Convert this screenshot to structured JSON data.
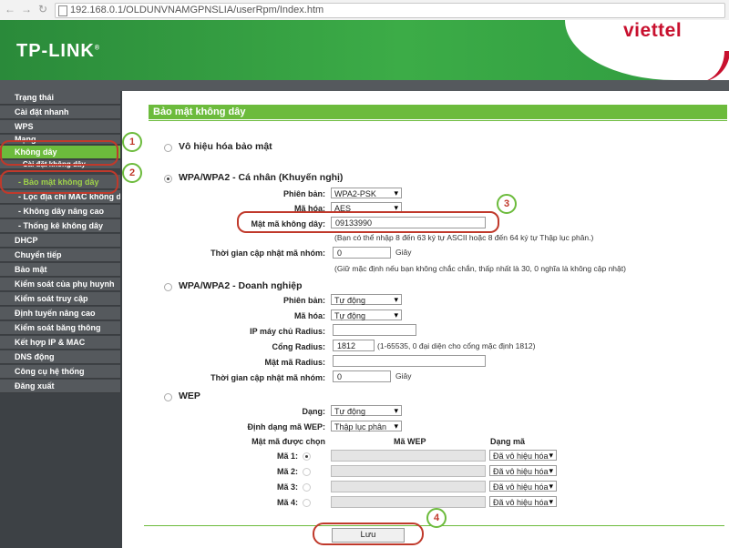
{
  "browser": {
    "url": "192.168.0.1/OLDUNVNAMGPNSLIA/userRpm/Index.htm"
  },
  "brand": {
    "logo": "TP-LINK",
    "trademark": "®",
    "isp_logo": "viettel"
  },
  "sidebar": {
    "items": [
      {
        "label": "Trạng thái"
      },
      {
        "label": "Cài đặt nhanh"
      },
      {
        "label": "WPS"
      },
      {
        "label": "Mạng"
      },
      {
        "label": "Không dây"
      },
      {
        "label": "- Cài đặt không dây"
      },
      {
        "label": "- Bảo mật không dây"
      },
      {
        "label": "- Lọc địa chỉ MAC không dây"
      },
      {
        "label": "- Không dây nâng cao"
      },
      {
        "label": "- Thống kê không dây"
      },
      {
        "label": "DHCP"
      },
      {
        "label": "Chuyển tiếp"
      },
      {
        "label": "Bảo mật"
      },
      {
        "label": "Kiểm soát của phụ huynh"
      },
      {
        "label": "Kiểm soát truy cập"
      },
      {
        "label": "Định tuyến nâng cao"
      },
      {
        "label": "Kiểm soát băng thông"
      },
      {
        "label": "Kết hợp IP & MAC"
      },
      {
        "label": "DNS động"
      },
      {
        "label": "Công cụ hệ thống"
      },
      {
        "label": "Đăng xuất"
      }
    ]
  },
  "main": {
    "title": "Bảo mật không dây",
    "disable": {
      "label": "Vô hiệu hóa bảo mật"
    },
    "wpa_personal": {
      "label": "WPA/WPA2 - Cá nhân (Khuyến nghị)",
      "version_label": "Phiên bản:",
      "version_value": "WPA2-PSK",
      "encryption_label": "Mã hóa:",
      "encryption_value": "AES",
      "password_label": "Mật mã không dây:",
      "password_value": "09133990",
      "password_hint": "(Bạn có thể nhập 8 đến 63 ký tự ASCII hoặc 8 đến 64 ký tự Thập lục phân.)",
      "group_key_label": "Thời gian cập nhật mã nhóm:",
      "group_key_value": "0",
      "group_key_unit": "Giây",
      "group_key_hint": "(Giữ mặc định nếu bạn không chắc chắn, thấp nhất là 30, 0 nghĩa là không cập nhật)"
    },
    "wpa_enterprise": {
      "label": "WPA/WPA2 - Doanh nghiệp",
      "version_label": "Phiên bản:",
      "version_value": "Tự động",
      "encryption_label": "Mã hóa:",
      "encryption_value": "Tự động",
      "radius_ip_label": "IP máy chủ Radius:",
      "radius_ip_value": "",
      "radius_port_label": "Cổng Radius:",
      "radius_port_value": "1812",
      "radius_port_hint": "(1-65535, 0 đại diện cho cổng mặc định 1812)",
      "radius_pw_label": "Mật mã Radius:",
      "radius_pw_value": "",
      "group_key_label": "Thời gian cập nhật mã nhóm:",
      "group_key_value": "0",
      "group_key_unit": "Giây"
    },
    "wep": {
      "label": "WEP",
      "type_label": "Dạng:",
      "type_value": "Tự động",
      "format_label": "Định dạng mã WEP:",
      "format_value": "Thập lục phân",
      "col_selected": "Mật mã được chọn",
      "col_key": "Mã WEP",
      "col_type": "Dạng mã",
      "keys": [
        {
          "label": "Mã 1:",
          "type": "Đã vô hiệu hóa"
        },
        {
          "label": "Mã 2:",
          "type": "Đã vô hiệu hóa"
        },
        {
          "label": "Mã 3:",
          "type": "Đã vô hiệu hóa"
        },
        {
          "label": "Mã 4:",
          "type": "Đã vô hiệu hóa"
        }
      ]
    },
    "save_label": "Lưu"
  },
  "annotations": [
    "1",
    "2",
    "3",
    "4"
  ]
}
